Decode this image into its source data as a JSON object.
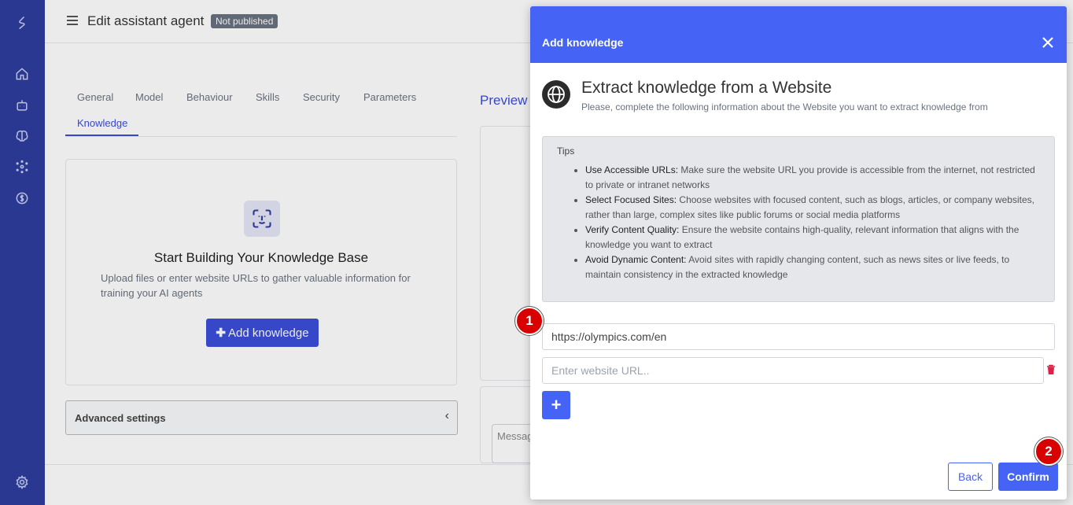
{
  "header": {
    "title": "Edit assistant agent",
    "status_badge": "Not published"
  },
  "tabs": [
    "General",
    "Model",
    "Behaviour",
    "Skills",
    "Security",
    "Parameters",
    "Knowledge"
  ],
  "knowledge_card": {
    "title": "Start Building Your Knowledge Base",
    "description": "Upload files or enter website URLs to gather valuable information for training your AI agents",
    "add_button": "Add knowledge"
  },
  "advanced_settings": "Advanced settings",
  "preview": {
    "title": "Preview",
    "message_placeholder": "Message"
  },
  "modal": {
    "header_title": "Add knowledge",
    "title": "Extract knowledge from a Website",
    "subtitle": "Please, complete the following information about the Website you want to extract knowledge from",
    "tips_title": "Tips",
    "tips": [
      {
        "bold": "Use Accessible URLs:",
        "text": " Make sure the website URL you provide is accessible from the internet, not restricted to private or intranet networks"
      },
      {
        "bold": "Select Focused Sites:",
        "text": " Choose websites with focused content, such as blogs, articles, or company websites, rather than large, complex sites like public forums or social media platforms"
      },
      {
        "bold": "Verify Content Quality:",
        "text": " Ensure the website contains high-quality, relevant information that aligns with the knowledge you want to extract"
      },
      {
        "bold": "Avoid Dynamic Content:",
        "text": " Avoid sites with rapidly changing content, such as news sites or live feeds, to maintain consistency in the extracted knowledge"
      }
    ],
    "url_value": "https://olympics.com/en",
    "url_placeholder": "Enter website URL..",
    "add_url_label": "+",
    "back_label": "Back",
    "confirm_label": "Confirm"
  },
  "steps": [
    "1",
    "2"
  ],
  "colors": {
    "sidebar": "#2e3d9e",
    "accent": "#4563f5",
    "step_marker": "#d90000"
  }
}
